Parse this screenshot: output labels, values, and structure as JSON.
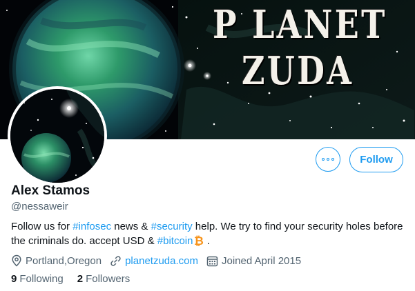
{
  "banner": {
    "line1": "P LANET",
    "line2": "ZUDA"
  },
  "profile": {
    "name": "Alex Stamos",
    "handle": "@nessaweir"
  },
  "actions": {
    "follow_label": "Follow",
    "more_icon": "more-horizontal-icon"
  },
  "bio": {
    "part1": "Follow us  for ",
    "tag1": "#infosec",
    "part2": " news & ",
    "tag2": "#security",
    "part3": " help. We try to find your security holes before the criminals do.  accept USD & ",
    "tag3": "#bitcoin",
    "bitcoin_icon": "bitcoin-icon",
    "part4": " ."
  },
  "meta": {
    "location": "Portland,Oregon",
    "website": "planetzuda.com",
    "joined": "Joined April 2015"
  },
  "counts": {
    "following_num": "9",
    "following_label": "Following",
    "followers_num": "2",
    "followers_label": "Followers"
  },
  "colors": {
    "accent": "#1d9bf0",
    "text": "#0f1419",
    "secondary": "#536471",
    "bitcoin": "#f7931a"
  }
}
